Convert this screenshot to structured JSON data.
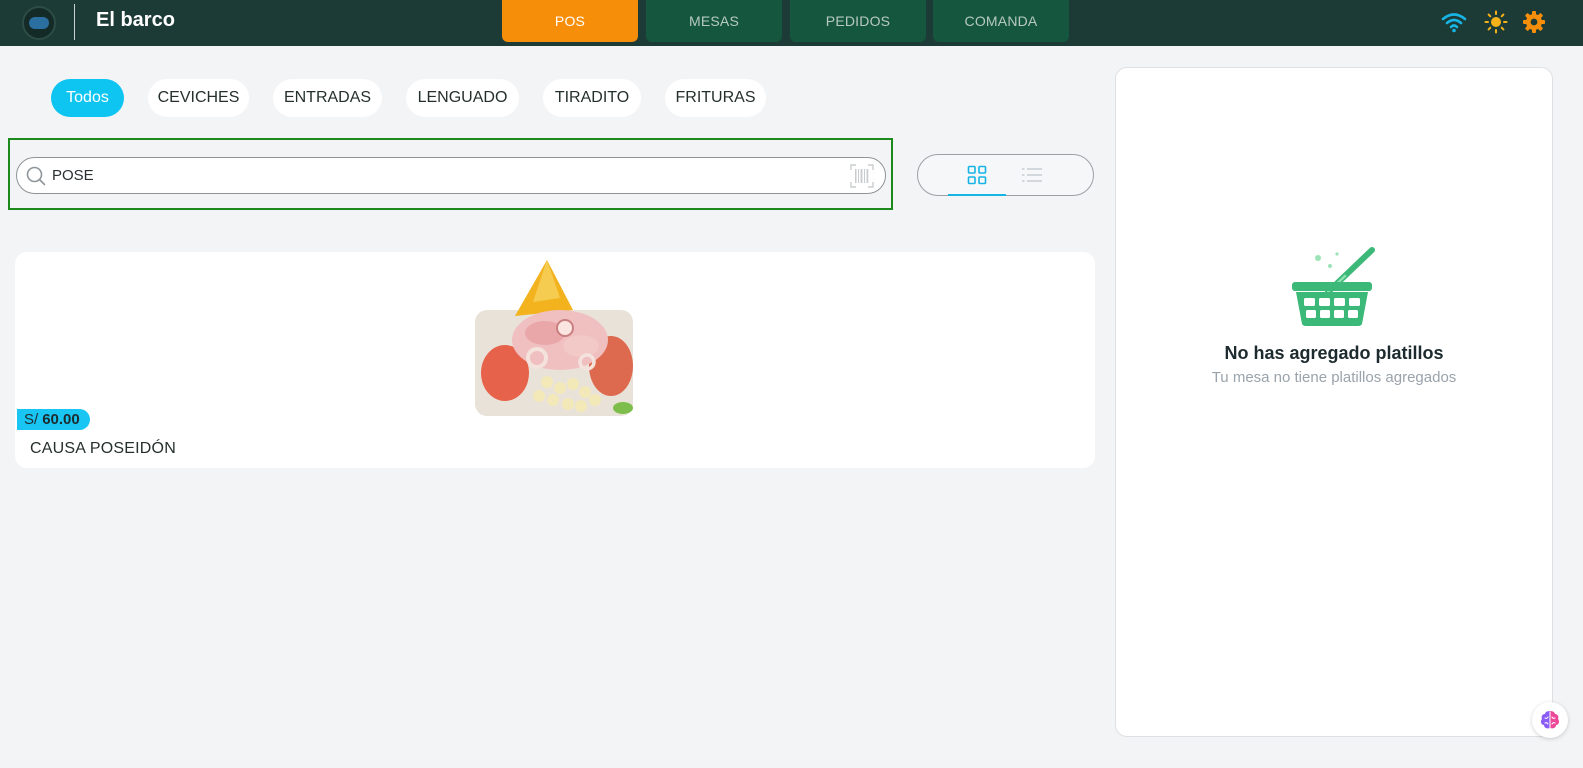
{
  "header": {
    "brand": "El barco",
    "logo_icon": "restaurant-logo",
    "tabs": [
      {
        "label": "POS",
        "active": true
      },
      {
        "label": "MESAS",
        "active": false
      },
      {
        "label": "PEDIDOS",
        "active": false
      },
      {
        "label": "COMANDA",
        "active": false
      }
    ],
    "icons": [
      "wifi-icon",
      "sun-icon",
      "gear-icon"
    ]
  },
  "categories": [
    {
      "label": "Todos",
      "active": true
    },
    {
      "label": "CEVICHES",
      "active": false
    },
    {
      "label": "ENTRADAS",
      "active": false
    },
    {
      "label": "LENGUADO",
      "active": false
    },
    {
      "label": "TIRADITO",
      "active": false
    },
    {
      "label": "FRITURAS",
      "active": false
    }
  ],
  "search": {
    "value": "POSE",
    "icon": "search-icon",
    "scan_icon": "barcode-icon"
  },
  "view_toggle": {
    "selected": "grid",
    "options": [
      "grid-icon",
      "list-icon"
    ]
  },
  "products": [
    {
      "name": "CAUSA POSEIDÓN",
      "currency": "S/",
      "price": "60.00",
      "image": "seafood-dish-image"
    }
  ],
  "cart": {
    "empty_title": "No has agregado platillos",
    "empty_subtitle": "Tu mesa no tiene platillos agregados",
    "icon": "basket-icon"
  },
  "colors": {
    "header_bg": "#1d3b36",
    "tab_bg": "#14573e",
    "tab_active": "#f78e0a",
    "accent": "#0ec5f2",
    "basket_green": "#3cb978"
  }
}
